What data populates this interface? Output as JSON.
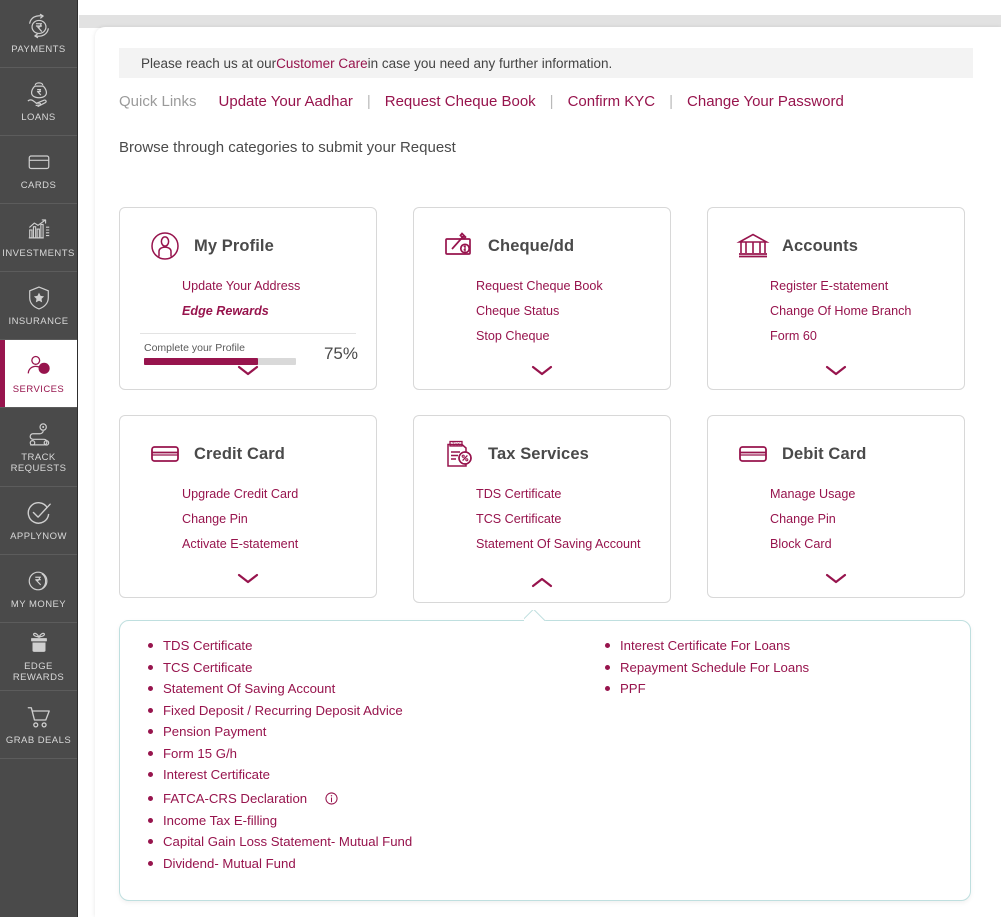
{
  "sidebar": {
    "items": [
      {
        "label": "PAYMENTS",
        "icon": "payments-icon",
        "active": false
      },
      {
        "label": "LOANS",
        "icon": "loans-icon",
        "active": false
      },
      {
        "label": "CARDS",
        "icon": "cards-icon",
        "active": false
      },
      {
        "label": "INVESTMENTS",
        "icon": "investments-icon",
        "active": false
      },
      {
        "label": "INSURANCE",
        "icon": "insurance-shield-icon",
        "active": false
      },
      {
        "label": "SERVICES",
        "icon": "services-user-icon",
        "active": true
      },
      {
        "label": "TRACK\nREQUESTS",
        "icon": "track-requests-icon",
        "active": false
      },
      {
        "label": "APPLYNOW",
        "icon": "apply-now-check-icon",
        "active": false
      },
      {
        "label": "MY MONEY",
        "icon": "my-money-rupee-icon",
        "active": false
      },
      {
        "label": "EDGE REWARDS",
        "icon": "edge-rewards-gift-icon",
        "active": false
      },
      {
        "label": "GRAB DEALS",
        "icon": "grab-deals-cart-icon",
        "active": false
      }
    ]
  },
  "notice": {
    "prefix": "Please reach us at our ",
    "link": "Customer Care",
    "suffix": " in case you need any further information."
  },
  "quick_links": {
    "title": "Quick Links",
    "separator": "|",
    "links": [
      "Update Your Aadhar",
      "Request Cheque Book",
      "Confirm KYC",
      "Change Your Password"
    ]
  },
  "browse_title": "Browse through categories to submit your Request",
  "cards": [
    {
      "title": "My Profile",
      "icon": "profile-avatar-icon",
      "links": [
        "Update Your Address",
        "Edge Rewards"
      ],
      "expanded": false,
      "chevron": "chevron-down-icon",
      "progress": {
        "label": "Complete your Profile",
        "percent_label": "75%",
        "percent": 75
      }
    },
    {
      "title": "Cheque/dd",
      "icon": "cheque-icon",
      "links": [
        "Request Cheque Book",
        "Cheque Status",
        "Stop Cheque"
      ],
      "expanded": false,
      "chevron": "chevron-down-icon"
    },
    {
      "title": "Accounts",
      "icon": "bank-building-icon",
      "links": [
        "Register E-statement",
        "Change Of Home Branch",
        "Form 60"
      ],
      "expanded": false,
      "chevron": "chevron-down-icon"
    },
    {
      "title": "Credit Card",
      "icon": "credit-card-icon",
      "links": [
        "Upgrade Credit Card",
        "Change Pin",
        "Activate E-statement"
      ],
      "expanded": false,
      "chevron": "chevron-down-icon"
    },
    {
      "title": "Tax Services",
      "icon": "tax-document-icon",
      "links": [
        "TDS Certificate",
        "TCS Certificate",
        "Statement Of Saving Account"
      ],
      "expanded": true,
      "chevron": "chevron-up-icon"
    },
    {
      "title": "Debit Card",
      "icon": "debit-card-icon",
      "links": [
        "Manage Usage",
        "Change Pin",
        "Block Card"
      ],
      "expanded": false,
      "chevron": "chevron-down-icon"
    }
  ],
  "dropdown": {
    "left_column": [
      {
        "label": "TDS Certificate",
        "info": false,
        "spaced": false
      },
      {
        "label": "TCS Certificate",
        "info": false,
        "spaced": false
      },
      {
        "label": "Statement Of Saving Account",
        "info": false,
        "spaced": false
      },
      {
        "label": "Fixed Deposit / Recurring Deposit Advice",
        "info": false,
        "spaced": false
      },
      {
        "label": "Pension Payment",
        "info": false,
        "spaced": false
      },
      {
        "label": "Form 15 G/h",
        "info": false,
        "spaced": false
      },
      {
        "label": "Interest Certificate",
        "info": false,
        "spaced": false
      },
      {
        "label": "FATCA-CRS Declaration",
        "info": true,
        "spaced": true
      },
      {
        "label": "Income Tax E-filling",
        "info": false,
        "spaced": false
      },
      {
        "label": "Capital Gain Loss Statement- Mutual Fund",
        "info": false,
        "spaced": false
      },
      {
        "label": "Dividend- Mutual Fund",
        "info": false,
        "spaced": false
      }
    ],
    "right_column": [
      {
        "label": "Interest Certificate For Loans",
        "info": false,
        "spaced": false
      },
      {
        "label": "Repayment Schedule For Loans",
        "info": false,
        "spaced": false
      },
      {
        "label": "PPF",
        "info": false,
        "spaced": false
      }
    ]
  },
  "colors": {
    "brand_maroon": "#97144d",
    "sidebar_bg": "#4a4a4a",
    "panel_border": "#bfdfdf",
    "notice_bg": "#f3f3f3",
    "text_dark": "#4a4a4a"
  }
}
